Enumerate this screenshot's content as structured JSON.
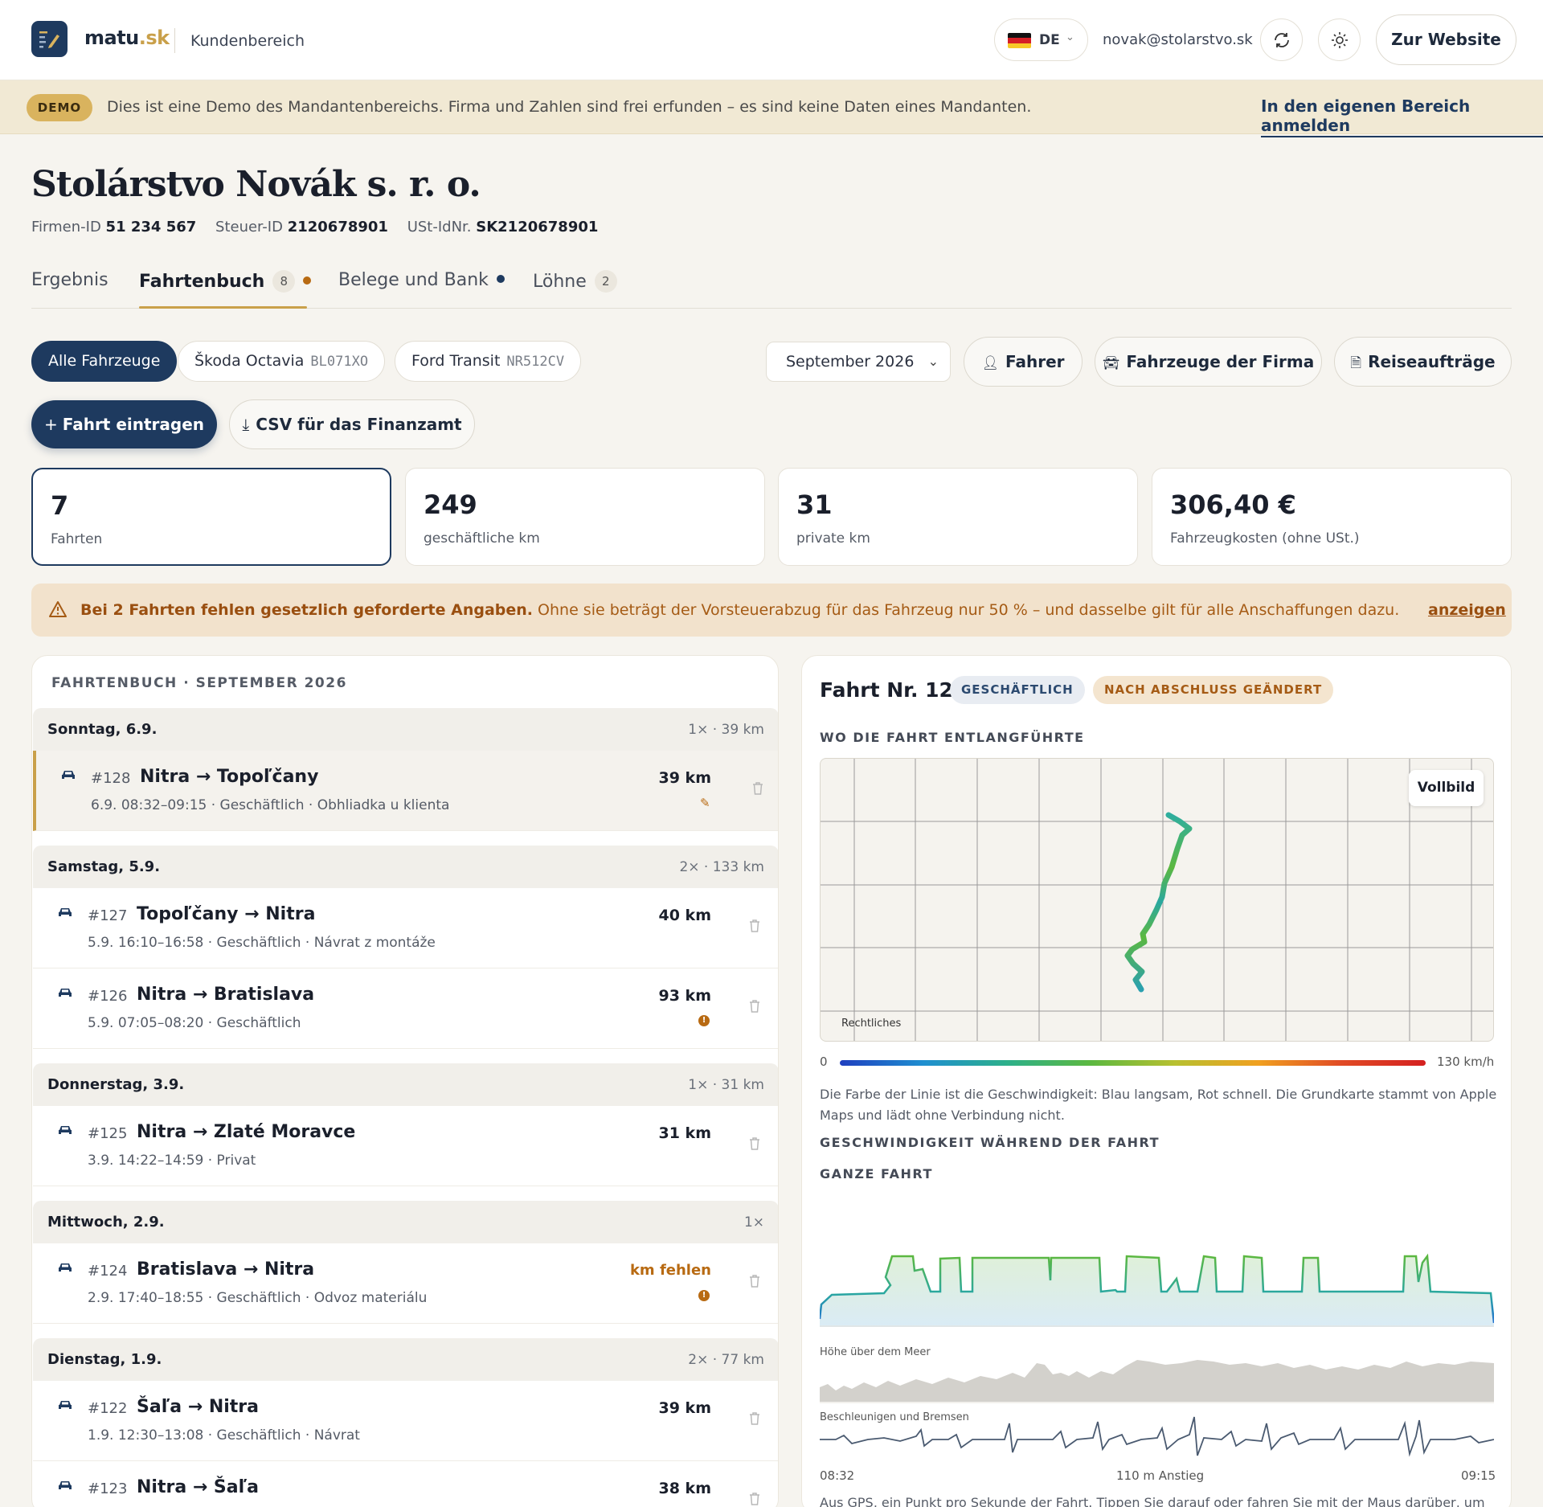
{
  "header": {
    "brand_name": "matu",
    "brand_tld": ".sk",
    "area_label": "Kundenbereich",
    "language": "DE",
    "user_email": "novak@stolarstvo.sk",
    "website_button": "Zur Website"
  },
  "demo": {
    "badge": "DEMO",
    "text": "Dies ist eine Demo des Mandantenbereichs. Firma und Zahlen sind frei erfunden – es sind keine Daten eines Mandanten.",
    "link": "In den eigenen Bereich anmelden"
  },
  "company": {
    "name": "Stolárstvo Novák s. r. o.",
    "firm_id_label": "Firmen-ID",
    "firm_id": "51 234 567",
    "tax_id_label": "Steuer-ID",
    "tax_id": "2120678901",
    "vat_id_label": "USt-IdNr.",
    "vat_id": "SK2120678901"
  },
  "tabs": [
    {
      "label": "Ergebnis"
    },
    {
      "label": "Fahrtenbuch",
      "count": "8"
    },
    {
      "label": "Belege und Bank"
    },
    {
      "label": "Löhne",
      "count": "2"
    }
  ],
  "filters": {
    "vehicles": [
      {
        "label": "Alle Fahrzeuge"
      },
      {
        "label": "Škoda Octavia",
        "plate": "BL071XO"
      },
      {
        "label": "Ford Transit",
        "plate": "NR512CV"
      }
    ],
    "month": "September 2026",
    "driver_button": "Fahrer",
    "fleet_button": "Fahrzeuge der Firma",
    "orders_button": "Reiseaufträge"
  },
  "actions": {
    "add_trip": "Fahrt eintragen",
    "export_csv": "CSV für das Finanzamt"
  },
  "stats": [
    {
      "value": "7",
      "label": "Fahrten"
    },
    {
      "value": "249",
      "label": "geschäftliche km"
    },
    {
      "value": "31",
      "label": "private km"
    },
    {
      "value": "306,40 €",
      "label": "Fahrzeugkosten (ohne USt.)"
    }
  ],
  "warning": {
    "bold": "Bei 2 Fahrten fehlen gesetzlich geforderte Angaben.",
    "text": " Ohne sie beträgt der Vorsteuerabzug für das Fahrzeug nur 50 % – und dasselbe gilt für alle Anschaffungen dazu.",
    "link": "anzeigen"
  },
  "logbook": {
    "title": "FAHRTENBUCH · SEPTEMBER 2026",
    "days": [
      {
        "name": "Sonntag, 6.9.",
        "stats": "1× · 39 km"
      },
      {
        "name": "Samstag, 5.9.",
        "stats": "2× · 133 km"
      },
      {
        "name": "Donnerstag, 3.9.",
        "stats": "1× · 31 km"
      },
      {
        "name": "Mittwoch, 2.9.",
        "stats": "1×"
      },
      {
        "name": "Dienstag, 1.9.",
        "stats": "2× · 77 km"
      }
    ],
    "trips": [
      {
        "no": "#128",
        "route": "Nitra → Topoľčany",
        "sub": "6.9. 08:32–09:15 · Geschäftlich · Obhliadka u klienta",
        "km": "39 km"
      },
      {
        "no": "#127",
        "route": "Topoľčany → Nitra",
        "sub": "5.9. 16:10–16:58 · Geschäftlich · Návrat z montáže",
        "km": "40 km"
      },
      {
        "no": "#126",
        "route": "Nitra → Bratislava",
        "sub": "5.9. 07:05–08:20 · Geschäftlich",
        "km": "93 km"
      },
      {
        "no": "#125",
        "route": "Nitra → Zlaté Moravce",
        "sub": "3.9. 14:22–14:59 · Privat",
        "km": "31 km"
      },
      {
        "no": "#124",
        "route": "Bratislava → Nitra",
        "sub": "2.9. 17:40–18:55 · Geschäftlich · Odvoz materiálu",
        "km": "km fehlen"
      },
      {
        "no": "#122",
        "route": "Šaľa → Nitra",
        "sub": "1.9. 12:30–13:08 · Geschäftlich · Návrat",
        "km": "39 km"
      },
      {
        "no": "#123",
        "route": "Nitra → Šaľa",
        "sub": "",
        "km": "38 km"
      }
    ]
  },
  "detail": {
    "title": "Fahrt Nr. 128",
    "badge_type": "GESCHÄFTLICH",
    "badge_status": "NACH ABSCHLUSS GEÄNDERT",
    "route_section": "WO DIE FAHRT ENTLANGFÜHRTE",
    "fullscreen": "Vollbild",
    "legal": "Rechtliches",
    "scale_min": "0",
    "scale_max": "130 km/h",
    "map_note": "Die Farbe der Linie ist die Geschwindigkeit: Blau langsam, Rot schnell. Die Grundkarte stammt von Apple Maps und lädt ohne Verbindung nicht.",
    "speed_section": "GESCHWINDIGKEIT WÄHREND DER FAHRT",
    "whole_trip": "GANZE FAHRT",
    "altitude_label": "Höhe über dem Meer",
    "accel_label": "Beschleunigen und Bremsen",
    "time_start": "08:32",
    "climb": "110 m Anstieg",
    "time_end": "09:15",
    "gps_note": "Aus GPS, ein Punkt pro Sekunde der Fahrt. Tippen Sie darauf oder fahren Sie mit der Maus darüber, um"
  },
  "colors": {
    "primary": "#1e3a5f",
    "accent": "#c9a04a",
    "warning": "#b86a12"
  }
}
